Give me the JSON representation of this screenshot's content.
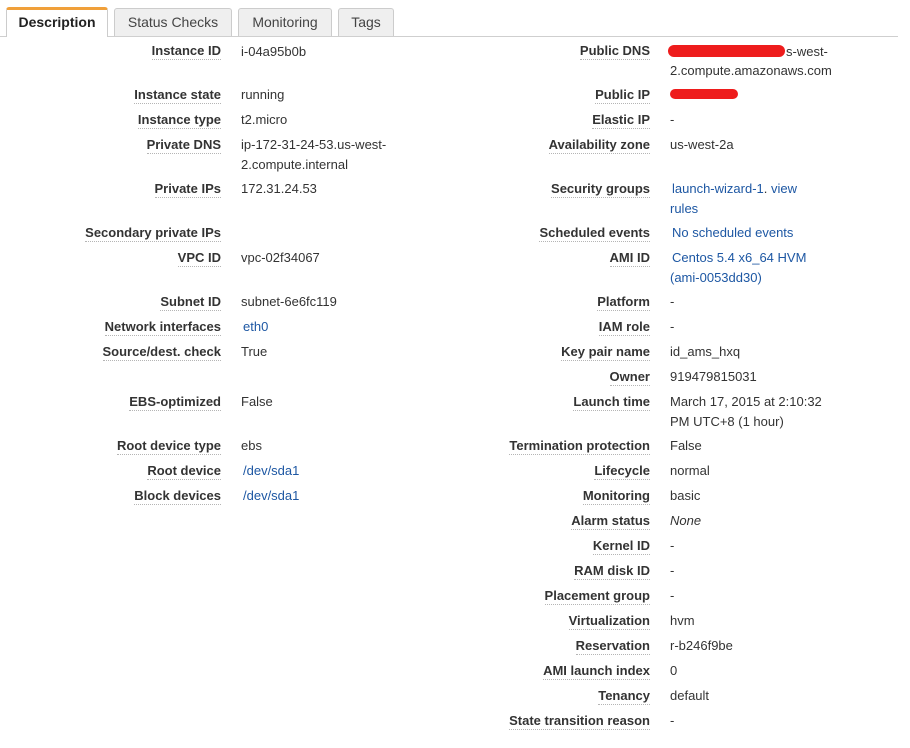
{
  "tabs": [
    "Description",
    "Status Checks",
    "Monitoring",
    "Tags"
  ],
  "left": {
    "instance_id": {
      "label": "Instance ID",
      "value": "i-04a95b0b"
    },
    "instance_state": {
      "label": "Instance state",
      "value": "running"
    },
    "instance_type": {
      "label": "Instance type",
      "value": "t2.micro"
    },
    "private_dns": {
      "label": "Private DNS",
      "value_line1": "ip-172-31-24-53.us-west-",
      "value_line2": "2.compute.internal"
    },
    "private_ips": {
      "label": "Private IPs",
      "value": "172.31.24.53"
    },
    "secondary_private_ips": {
      "label": "Secondary private IPs",
      "value": ""
    },
    "vpc_id": {
      "label": "VPC ID",
      "value": "vpc-02f34067"
    },
    "subnet_id": {
      "label": "Subnet ID",
      "value": "subnet-6e6fc119"
    },
    "network_interfaces": {
      "label": "Network interfaces",
      "value": "eth0"
    },
    "source_dest_check": {
      "label": "Source/dest. check",
      "value": "True"
    },
    "ebs_optimized": {
      "label": "EBS-optimized",
      "value": "False"
    },
    "root_device_type": {
      "label": "Root device type",
      "value": "ebs"
    },
    "root_device": {
      "label": "Root device",
      "value": "/dev/sda1"
    },
    "block_devices": {
      "label": "Block devices",
      "value": "/dev/sda1"
    }
  },
  "right": {
    "public_dns": {
      "label": "Public DNS",
      "value_line1": "s-west-",
      "value_line2": "2.compute.amazonaws.com"
    },
    "public_ip": {
      "label": "Public IP"
    },
    "elastic_ip": {
      "label": "Elastic IP",
      "value": "-"
    },
    "availability_zone": {
      "label": "Availability zone",
      "value": "us-west-2a"
    },
    "security_groups": {
      "label": "Security groups",
      "link1": "launch-wizard-1",
      "sep": ". ",
      "link2a": "view",
      "link2b": "rules"
    },
    "scheduled_events": {
      "label": "Scheduled events",
      "value": "No scheduled events"
    },
    "ami_id": {
      "label": "AMI ID",
      "value_line1": "Centos 5.4 x6_64 HVM",
      "value_line2": "(ami-0053dd30)"
    },
    "platform": {
      "label": "Platform",
      "value": "-"
    },
    "iam_role": {
      "label": "IAM role",
      "value": "-"
    },
    "key_pair_name": {
      "label": "Key pair name",
      "value": "id_ams_hxq"
    },
    "owner": {
      "label": "Owner",
      "value": "919479815031"
    },
    "launch_time": {
      "label": "Launch time",
      "value_line1": "March 17, 2015 at 2:10:32",
      "value_line2": "PM UTC+8 (1 hour)"
    },
    "termination_protection": {
      "label": "Termination protection",
      "value": "False"
    },
    "lifecycle": {
      "label": "Lifecycle",
      "value": "normal"
    },
    "monitoring": {
      "label": "Monitoring",
      "value": "basic"
    },
    "alarm_status": {
      "label": "Alarm status",
      "value": "None"
    },
    "kernel_id": {
      "label": "Kernel ID",
      "value": "-"
    },
    "ram_disk_id": {
      "label": "RAM disk ID",
      "value": "-"
    },
    "placement_group": {
      "label": "Placement group",
      "value": "-"
    },
    "virtualization": {
      "label": "Virtualization",
      "value": "hvm"
    },
    "reservation": {
      "label": "Reservation",
      "value": "r-b246f9be"
    },
    "ami_launch_index": {
      "label": "AMI launch index",
      "value": "0"
    },
    "tenancy": {
      "label": "Tenancy",
      "value": "default"
    },
    "state_transition_reason": {
      "label": "State transition reason",
      "value": "-"
    }
  },
  "colors": {
    "link": "#1d57a3",
    "active_tab_accent": "#f0a03a",
    "redaction": "#ee1c1c"
  }
}
